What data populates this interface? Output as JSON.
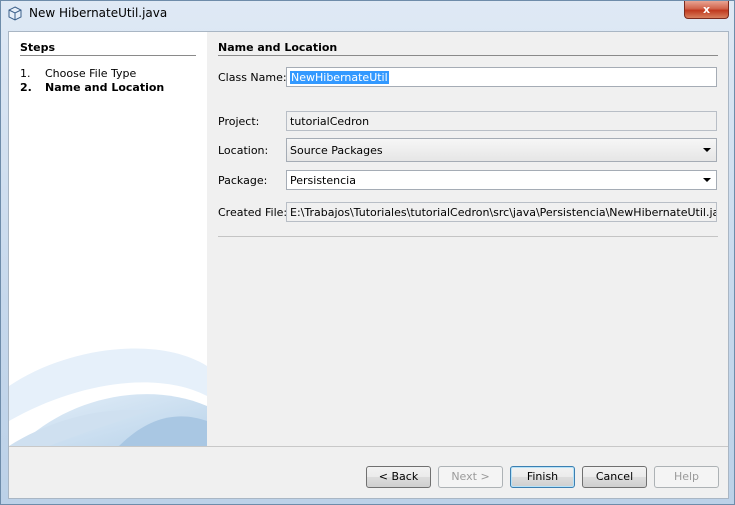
{
  "window": {
    "title": "New HibernateUtil.java",
    "close_glyph": "x"
  },
  "steps": {
    "title": "Steps",
    "items": [
      {
        "num": "1.",
        "label": "Choose File Type"
      },
      {
        "num": "2.",
        "label": "Name and Location"
      }
    ]
  },
  "panel": {
    "title": "Name and Location",
    "class_name": {
      "label": "Class Name:",
      "value": "NewHibernateUtil"
    },
    "project": {
      "label": "Project:",
      "value": "tutorialCedron"
    },
    "location": {
      "label": "Location:",
      "value": "Source Packages"
    },
    "package": {
      "label": "Package:",
      "value": "Persistencia"
    },
    "created_file": {
      "label": "Created File:",
      "value": "E:\\Trabajos\\Tutoriales\\tutorialCedron\\src\\java\\Persistencia\\NewHibernateUtil.java"
    }
  },
  "buttons": {
    "back": "< Back",
    "next": "Next >",
    "finish": "Finish",
    "cancel": "Cancel",
    "help": "Help"
  },
  "icons": {
    "app": "netbeans-cube-icon",
    "close": "close-icon",
    "dropdown": "chevron-down-icon"
  }
}
